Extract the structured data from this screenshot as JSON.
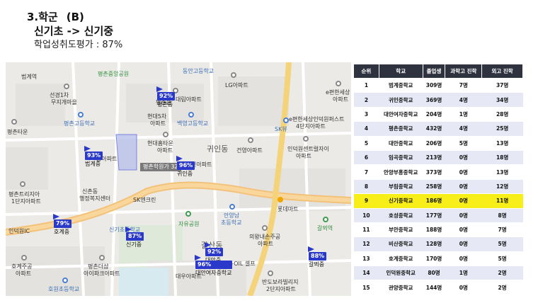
{
  "header": {
    "section": "3.학군",
    "variant": "(B)",
    "route": "신기초 -> 신기중",
    "rating": "학업성취도평가 : 87%"
  },
  "map": {
    "tooltip": "평촌학원가 32",
    "labels": {
      "beomgye_station": "범계역",
      "pyeongchon_park": "평촌중앙공원",
      "donghwa_high": "동안고등학교",
      "lg_apt": "LG아파트",
      "e_pyeonhan_top": "e편한세상",
      "e_pyeonhan_top2": "아파트",
      "seonkyung": "선경1차",
      "mujigae": "무지개마을",
      "pyeongchon_mid": "평촌중",
      "daerim": "대림아파트",
      "hyundai5": "현대5차",
      "hyundai5_b": "아파트",
      "pyeongchon_high": "평촌고등학교",
      "baekyoung_high": "백영고등학교",
      "skview": "SK뷰",
      "e_pyeonhan_mid": "e편한세상인덕원퍼스트",
      "e_pyeonhan_mid2": "4단지아파트",
      "pyeongchon_town": "평촌타운",
      "hyundai_home": "현대홈타운",
      "hyundai_home2": "아파트",
      "gwiin_dong": "귀인동",
      "geonyoung": "건영아파트",
      "induk_gold": "인덕원센트럴자이",
      "induk_gold2": "아파트",
      "beomgye_mid": "범계중",
      "nammu": "남아파트",
      "gwiin_mid": "귀인중",
      "hyundai_apt": "신아파트",
      "pyeongchon_tree": "평촌트리지아",
      "pyeongchon_tree2": "1단지아파트",
      "sinchon": "신촌동",
      "hangjeong": "행정복지센터",
      "sk_view": "SK엔크린",
      "lotte_mart": "롯데마트",
      "jayu_park": "자유공원",
      "anyang_elem": "안양남",
      "anyang_elem2": "초등학교",
      "galme_station": "갈뫼역",
      "hogye_mid": "호계중",
      "singi_elem": "신기초등학교",
      "singi_mid": "신기중",
      "galsan": "갈산동",
      "euiwang": "의왕내손주공",
      "euiwang2": "아파트",
      "hogye_apt": "호계주공",
      "hogye_apt2": "아파트",
      "pyeongchon_district": "평촌더샵",
      "pyeongchon_district2": "아이파크아파트",
      "daewoo": "대우아파트",
      "s_oil": "S-OIL 셀프",
      "banpo": "반도보라빌리지",
      "banpo2": "2단지아파트",
      "hogye_elem": "호원초등학교",
      "galmo": "갈뫼중",
      "interchange": "인덕원IC"
    },
    "flags": [
      {
        "pct": "92%",
        "name": "평촌중"
      },
      {
        "pct": "93%",
        "name": "범계중"
      },
      {
        "pct": "96%",
        "name": "귀인중"
      },
      {
        "pct": "79%",
        "name": "호계중"
      },
      {
        "pct": "87%",
        "name": "신기중"
      },
      {
        "pct": "92%",
        "name": "대안중"
      },
      {
        "pct": "96%",
        "name": "대안여자중학교"
      },
      {
        "pct": "88%",
        "name": "갈뫼중"
      }
    ]
  },
  "table": {
    "headers": [
      "순위",
      "학교",
      "졸업생",
      "과학고 진학",
      "외고 진학"
    ],
    "rows": [
      [
        "1",
        "범계중학교",
        "309명",
        "7명",
        "37명"
      ],
      [
        "2",
        "귀인중학교",
        "369명",
        "4명",
        "34명"
      ],
      [
        "3",
        "대안여자중학교",
        "204명",
        "1명",
        "28명"
      ],
      [
        "4",
        "평촌중학교",
        "432명",
        "4명",
        "25명"
      ],
      [
        "5",
        "대안중학교",
        "206명",
        "5명",
        "13명"
      ],
      [
        "6",
        "임곡중학교",
        "213명",
        "0명",
        "18명"
      ],
      [
        "7",
        "안양부흥중학교",
        "373명",
        "0명",
        "13명"
      ],
      [
        "8",
        "부림중학교",
        "258명",
        "0명",
        "12명"
      ],
      [
        "9",
        "신기중학교",
        "186명",
        "0명",
        "11명"
      ],
      [
        "10",
        "호성중학교",
        "177명",
        "0명",
        "8명"
      ],
      [
        "11",
        "부안중학교",
        "188명",
        "0명",
        "7명"
      ],
      [
        "12",
        "비산중학교",
        "128명",
        "0명",
        "5명"
      ],
      [
        "13",
        "호계중학교",
        "170명",
        "0명",
        "5명"
      ],
      [
        "14",
        "인덕원중학교",
        "80명",
        "1명",
        "2명"
      ],
      [
        "15",
        "관양중학교",
        "144명",
        "0명",
        "2명"
      ]
    ],
    "highlight_row": "9",
    "colors": {
      "header_bg": "#2f3340",
      "alt_row": "#e6e9f5",
      "highlight": "#f7ee1a",
      "flag": "#2a39c9"
    }
  }
}
